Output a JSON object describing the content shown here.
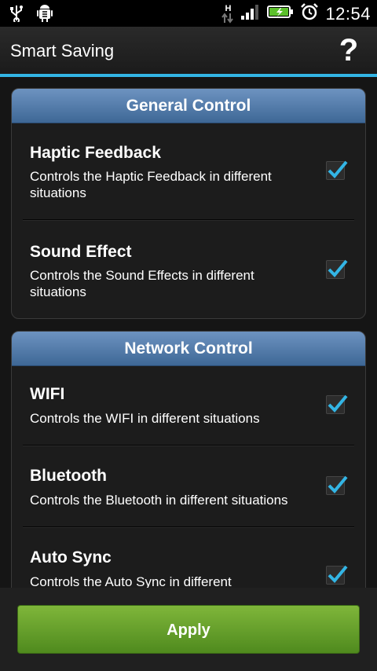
{
  "status_bar": {
    "time": "12:54",
    "network_type": "H",
    "icons": [
      "usb-icon",
      "android-debug-icon",
      "data-transfer-icon",
      "signal-icon",
      "battery-charging-icon",
      "alarm-icon"
    ]
  },
  "action_bar": {
    "title": "Smart Saving",
    "help_label": "?"
  },
  "sections": [
    {
      "header": "General Control",
      "items": [
        {
          "title": "Haptic Feedback",
          "description": "Controls the Haptic Feedback in different situations",
          "checked": true
        },
        {
          "title": "Sound Effect",
          "description": "Controls the Sound Effects in different situations",
          "checked": true
        }
      ]
    },
    {
      "header": "Network Control",
      "items": [
        {
          "title": "WIFI",
          "description": "Controls the WIFI in different situations",
          "checked": true
        },
        {
          "title": "Bluetooth",
          "description": "Controls the Bluetooth in different situations",
          "checked": true
        },
        {
          "title": "Auto Sync",
          "description": "Controls the Auto Sync in different",
          "checked": true
        }
      ]
    }
  ],
  "apply_label": "Apply",
  "colors": {
    "accent": "#33b5e5",
    "section_header": "#5a82b0",
    "apply_button": "#6aa22e",
    "checkmark": "#33b5e5"
  }
}
